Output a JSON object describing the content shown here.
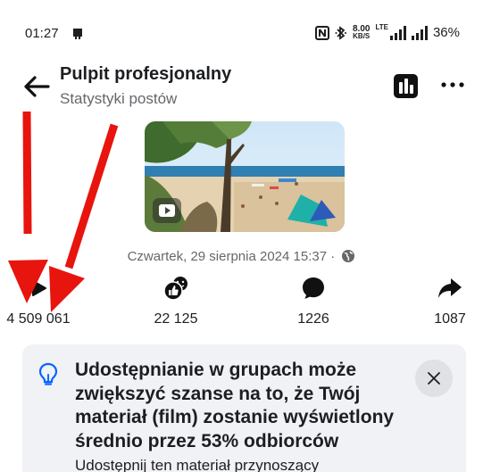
{
  "status_bar": {
    "time": "01:27",
    "net_speed": "8.00",
    "net_unit": "KB/S",
    "net_type": "LTE",
    "battery": "36%"
  },
  "header": {
    "title": "Pulpit profesjonalny",
    "subtitle": "Statystyki postów"
  },
  "post": {
    "date": "Czwartek, 29 sierpnia 2024 15:37 ·"
  },
  "stats": [
    {
      "icon": "play-icon",
      "value": "4 509 061"
    },
    {
      "icon": "reactions-icon",
      "value": "22 125"
    },
    {
      "icon": "comment-icon",
      "value": "1226"
    },
    {
      "icon": "share-icon",
      "value": "1087"
    }
  ],
  "info_card": {
    "title": "Udostępnianie w grupach może zwiększyć szanse na to, że Twój materiał (film) zostanie wyświetlony średnio przez 53% odbiorców",
    "body": "Udostępnij ten materiał przynoszący"
  },
  "colors": {
    "accent_blue": "#0866ff",
    "annotation_red": "#e8140e",
    "card_bg": "#f0f2f5"
  }
}
